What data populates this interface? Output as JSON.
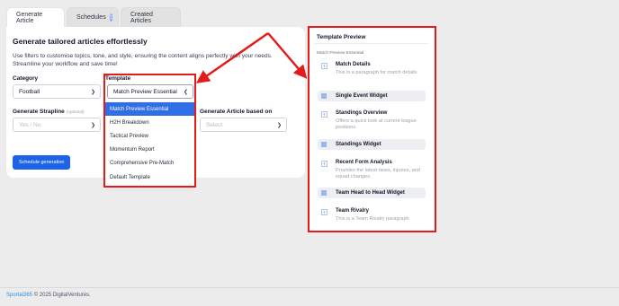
{
  "tabs": [
    {
      "label": "Generate Article",
      "active": true
    },
    {
      "label": "Schedules",
      "badge": "1"
    },
    {
      "label": "Created Articles"
    }
  ],
  "card": {
    "title": "Generate tailored articles effortlessly",
    "description": "Use filters to customise topics, tone, and style, ensuring the content aligns perfectly with your needs. Streamline your workflow and save time!"
  },
  "form": {
    "category_label": "Category",
    "category_value": "Football",
    "template_label": "Template",
    "template_value": "Match Preview Essential",
    "strapline_label": "Generate Strapline",
    "strapline_optional": "(optional)",
    "strapline_placeholder": "Yes / No",
    "based_on_label": "Generate Article based on",
    "based_on_placeholder": "Select",
    "schedule_button": "Schedule generation"
  },
  "dropdown": {
    "options": [
      "Match Preview Essential",
      "H2H Breakdown",
      "Tactical Preview",
      "Momentum Report",
      "Comprehensive Pre-Match",
      "Default Template"
    ],
    "selected_index": 0
  },
  "preview": {
    "title": "Template Preview",
    "subtitle": "Match Preview Essential",
    "items": {
      "match_details": {
        "title": "Match Details",
        "desc": "This is a paragraph for match details"
      },
      "single_event": {
        "title": "Single Event Widget"
      },
      "standings_overview": {
        "title": "Standings Overview",
        "desc": "Offers a quick look at current league positions."
      },
      "standings_widget": {
        "title": "Standings Widget"
      },
      "recent_form": {
        "title": "Recent Form Analysis",
        "desc": "Provides the latest news, injuries, and squad changes."
      },
      "h2h_widget": {
        "title": "Team Head to Head Widget"
      },
      "team_rivalry": {
        "title": "Team Rivalry",
        "desc": "This is a Team Rivalry paragraph"
      }
    }
  },
  "footer": {
    "brand": "Sportal365",
    "text": "© 2025 DigitalVentures."
  },
  "colors": {
    "accent": "#1d63e8",
    "annotation": "#e41b1b",
    "selected_option": "#2f6ee6"
  }
}
